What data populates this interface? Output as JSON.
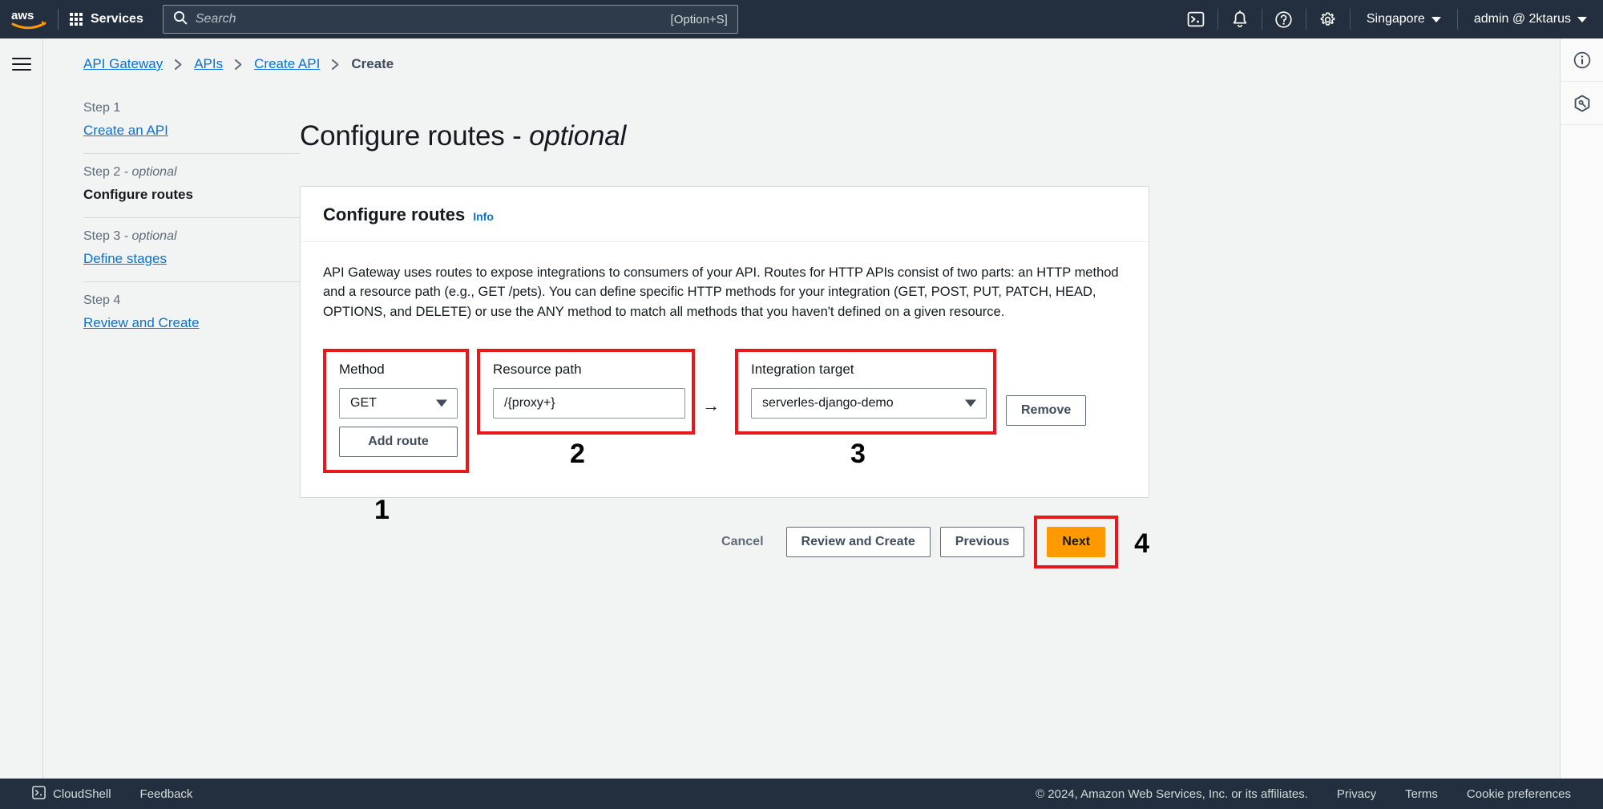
{
  "topnav": {
    "logo_alt": "aws",
    "services_label": "Services",
    "search": {
      "placeholder": "Search",
      "shortcut": "[Option+S]"
    },
    "icons": [
      "cloudshell-icon",
      "bell-icon",
      "help-icon",
      "gear-icon"
    ],
    "region": "Singapore",
    "account": "admin @ 2ktarus"
  },
  "breadcrumb": [
    {
      "label": "API Gateway",
      "link": true
    },
    {
      "label": "APIs",
      "link": true
    },
    {
      "label": "Create API",
      "link": true
    },
    {
      "label": "Create",
      "link": false
    }
  ],
  "wizard": {
    "steps": [
      {
        "num": "Step 1",
        "optional": "",
        "title": "Create an API",
        "active": false
      },
      {
        "num": "Step 2",
        "optional": " - optional",
        "title": "Configure routes",
        "active": true
      },
      {
        "num": "Step 3",
        "optional": " - optional",
        "title": "Define stages",
        "active": false
      },
      {
        "num": "Step 4",
        "optional": "",
        "title": "Review and Create",
        "active": false
      }
    ]
  },
  "main": {
    "page_title": "Configure routes - ",
    "page_title_em": "optional",
    "card": {
      "header": "Configure routes",
      "info_label": "Info",
      "description": "API Gateway uses routes to expose integrations to consumers of your API. Routes for HTTP APIs consist of two parts: an HTTP method and a resource path (e.g., GET /pets). You can define specific HTTP methods for your integration (GET, POST, PUT, PATCH, HEAD, OPTIONS, and DELETE) or use the ANY method to match all methods that you haven't defined on a given resource.",
      "route": {
        "method_label": "Method",
        "method_value": "GET",
        "add_route_label": "Add route",
        "path_label": "Resource path",
        "path_value": "/{proxy+}",
        "arrow": "→",
        "target_label": "Integration target",
        "target_value": "serverles-django-demo",
        "remove_label": "Remove"
      }
    },
    "actions": {
      "cancel": "Cancel",
      "review_and_create": "Review and Create",
      "previous": "Previous",
      "next": "Next"
    }
  },
  "annotations": {
    "one": "1",
    "two": "2",
    "three": "3",
    "four": "4",
    "highlight_color": "#e8191c"
  },
  "rightrail": {
    "icons": [
      "info-circle-icon",
      "settings-hex-icon"
    ]
  },
  "bottombar": {
    "cloudshell": "CloudShell",
    "feedback": "Feedback",
    "copyright": "© 2024, Amazon Web Services, Inc. or its affiliates.",
    "privacy": "Privacy",
    "terms": "Terms",
    "cookie_preferences": "Cookie preferences"
  },
  "colors": {
    "nav_bg": "#232f3e",
    "accent_orange": "#ff9900",
    "link_blue": "#0972d3",
    "page_bg": "#f2f3f3"
  }
}
